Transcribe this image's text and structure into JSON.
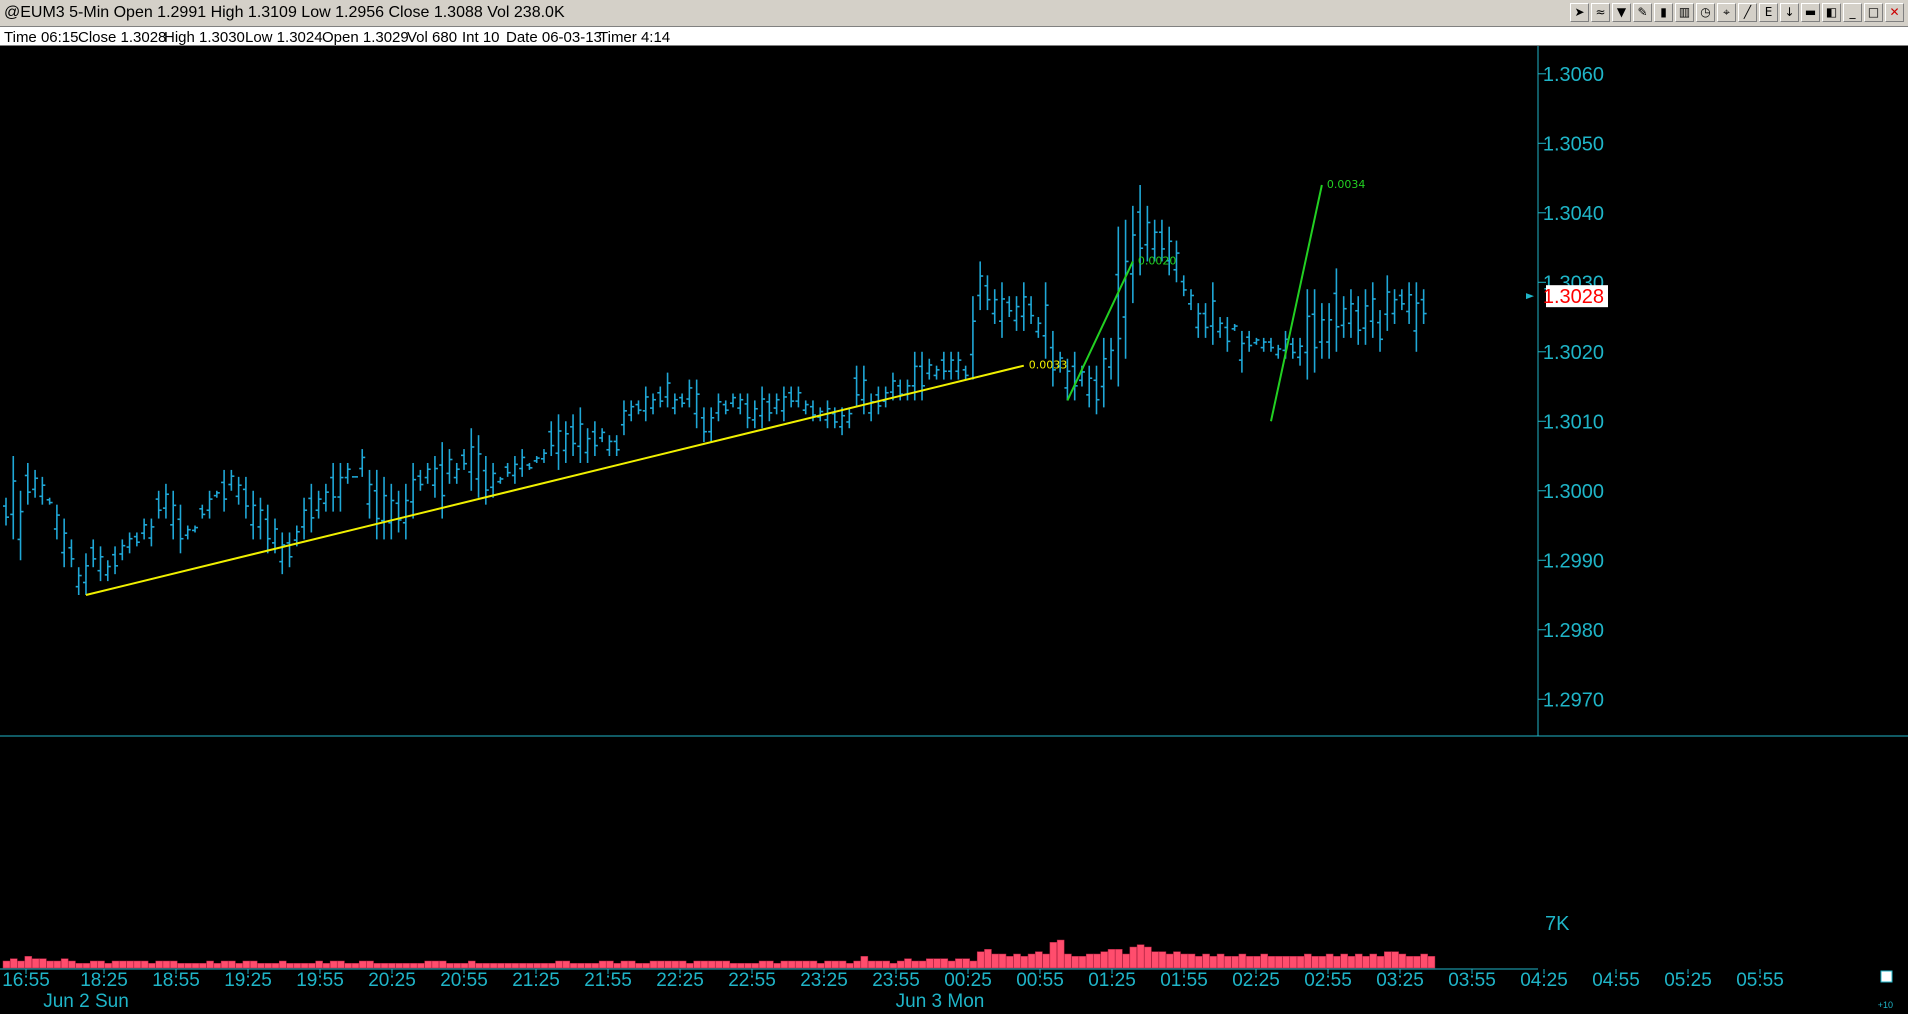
{
  "window": {
    "title": "@EUM3 5-Min Open 1.2991 High 1.3109 Low 1.2956 Close 1.3088 Vol 238.0K",
    "toolbar_icons": [
      "cursor-icon",
      "fibonacci-icon",
      "filter-icon",
      "pencil-icon",
      "bars-icon",
      "chart-icon",
      "clock-icon",
      "crosshair-icon",
      "trendline-icon",
      "text-icon",
      "arrow-down-icon",
      "trash-icon",
      "mirror-icon",
      "minimize-icon",
      "restore-icon",
      "close-icon"
    ],
    "toolbar_glyphs": [
      "➤",
      "≈",
      "▼",
      "✎",
      "▮",
      "▥",
      "◷",
      "⌖",
      "╱",
      "E",
      "↓",
      "▬",
      "◧",
      "_",
      "□",
      "✕"
    ]
  },
  "infobar": {
    "time": "Time 06:15",
    "close": "Close 1.3028",
    "high": "High 1.3030",
    "low": "Low 1.3024",
    "open": "Open 1.3029",
    "vol": "Vol 680",
    "int": "Int 10",
    "date": "Date 06-03-13",
    "timer": "Timer 4:14"
  },
  "colors": {
    "background": "#000000",
    "bars": "#1fa7d6",
    "axis": "#1fb5c8",
    "yellow_line": "#f0f000",
    "green_line": "#22d022",
    "last_price_bg": "#ffffff",
    "last_price_text": "#ff0000",
    "volume": "#ff4d6d"
  },
  "chart_data": {
    "type": "bar",
    "subtype": "ohlc",
    "ylim": [
      1.2965,
      1.3064
    ],
    "y_ticks": [
      "1.3060",
      "1.3050",
      "1.3040",
      "1.3030",
      "1.3020",
      "1.3010",
      "1.3000",
      "1.2990",
      "1.2980",
      "1.2970"
    ],
    "x_tick_labels": [
      "16:55",
      "18:25",
      "18:55",
      "19:25",
      "19:55",
      "20:25",
      "20:55",
      "21:25",
      "21:55",
      "22:25",
      "22:55",
      "23:25",
      "23:55",
      "00:25",
      "00:55",
      "01:25",
      "01:55",
      "02:25",
      "02:55",
      "03:25",
      "03:55",
      "04:25",
      "04:55",
      "05:25",
      "05:55"
    ],
    "date_labels": [
      "Jun 2 Sun",
      "Jun 3 Mon"
    ],
    "last_price": "1.3028",
    "volume_label": "7K",
    "corner_label": "+10",
    "lows": [
      1.2995,
      1.2993,
      1.299,
      1.2998,
      1.2999,
      1.2998,
      1.2998,
      1.2993,
      1.2989,
      1.2989,
      1.2985,
      1.2985,
      1.2989,
      1.2987,
      1.2987,
      1.2988,
      1.299,
      1.2991,
      1.2992,
      1.2993,
      1.2992,
      1.2996,
      1.2996,
      1.2993,
      1.2991,
      1.2993,
      1.2994,
      1.2996,
      1.2996,
      1.2999,
      1.2997,
      1.3,
      1.2998,
      1.2996,
      1.2993,
      1.2993,
      1.2991,
      1.2991,
      1.2988,
      1.2989,
      1.2992,
      1.2993,
      1.2994,
      1.2996,
      1.2997,
      1.2997,
      1.2997,
      1.3001,
      1.3002,
      1.3002,
      1.2996,
      1.2993,
      1.2993,
      1.2993,
      1.2994,
      1.2993,
      1.2996,
      1.3,
      1.3001,
      1.2999,
      1.2996,
      1.3001,
      1.3001,
      1.3003,
      1.3,
      1.2999,
      1.2998,
      1.2999,
      1.3001,
      1.3002,
      1.3001,
      1.3002,
      1.3003,
      1.3004,
      1.3004,
      1.3005,
      1.3003,
      1.3004,
      1.3005,
      1.3004,
      1.3004,
      1.3005,
      1.3007,
      1.3005,
      1.3005,
      1.3008,
      1.301,
      1.3011,
      1.301,
      1.3011,
      1.3012,
      1.3012,
      1.3011,
      1.3012,
      1.3012,
      1.3009,
      1.3007,
      1.3007,
      1.301,
      1.3011,
      1.3012,
      1.3011,
      1.3009,
      1.3009,
      1.3009,
      1.301,
      1.3011,
      1.301,
      1.3012,
      1.3012,
      1.3011,
      1.301,
      1.301,
      1.3009,
      1.3009,
      1.3008,
      1.3009,
      1.3012,
      1.3011,
      1.301,
      1.3011,
      1.3012,
      1.3013,
      1.3013,
      1.3013,
      1.3013,
      1.3013,
      1.3016,
      1.3016,
      1.3016,
      1.3016,
      1.3016,
      1.3016,
      1.3016,
      1.3026,
      1.3026,
      1.3024,
      1.3022,
      1.3025,
      1.3023,
      1.3023,
      1.3024,
      1.3022,
      1.3019,
      1.3015,
      1.3017,
      1.3013,
      1.3013,
      1.3015,
      1.3012,
      1.3011,
      1.3012,
      1.3016,
      1.3015,
      1.3019,
      1.3027,
      1.3031,
      1.3033,
      1.3033,
      1.3033,
      1.3031,
      1.303,
      1.3028,
      1.3026,
      1.3022,
      1.3022,
      1.3021,
      1.3022,
      1.302,
      1.3023,
      1.3017,
      1.302,
      1.3021,
      1.302,
      1.302,
      1.3019,
      1.3019,
      1.3019,
      1.3018,
      1.3016,
      1.3017,
      1.3019,
      1.3019,
      1.302,
      1.3022,
      1.3022,
      1.3021,
      1.3021,
      1.3022,
      1.302,
      1.3023,
      1.3024,
      1.3026,
      1.3024,
      1.302,
      1.3024,
      1.3026,
      1.3024
    ],
    "highs": [
      1.2999,
      1.3005,
      1.3,
      1.3004,
      1.3003,
      1.3002,
      1.2999,
      1.2998,
      1.2996,
      1.2993,
      1.2989,
      1.2991,
      1.2993,
      1.2992,
      1.299,
      1.2992,
      1.2993,
      1.2994,
      1.2994,
      1.2996,
      1.2996,
      1.3,
      1.3001,
      1.3,
      1.2998,
      1.2995,
      1.2995,
      1.2998,
      1.3,
      1.3,
      1.3003,
      1.3003,
      1.3002,
      1.3002,
      1.3,
      1.2999,
      1.2998,
      1.2996,
      1.2994,
      1.2994,
      1.2995,
      1.2999,
      1.3001,
      1.3,
      1.3001,
      1.3004,
      1.3004,
      1.3004,
      1.3002,
      1.3006,
      1.3003,
      1.3003,
      1.3002,
      1.3001,
      1.3,
      1.3001,
      1.3004,
      1.3003,
      1.3004,
      1.3005,
      1.3007,
      1.3006,
      1.3004,
      1.3006,
      1.3009,
      1.3008,
      1.3005,
      1.3004,
      1.3002,
      1.3004,
      1.3005,
      1.3006,
      1.3004,
      1.3005,
      1.3006,
      1.301,
      1.3011,
      1.301,
      1.3011,
      1.3012,
      1.3009,
      1.301,
      1.3009,
      1.3008,
      1.3008,
      1.3013,
      1.3013,
      1.3013,
      1.3015,
      1.3014,
      1.3015,
      1.3017,
      1.3014,
      1.3014,
      1.3016,
      1.3016,
      1.3012,
      1.3012,
      1.3014,
      1.3013,
      1.3014,
      1.3014,
      1.3014,
      1.3013,
      1.3015,
      1.3014,
      1.3014,
      1.3015,
      1.3015,
      1.3015,
      1.3013,
      1.3013,
      1.3012,
      1.3013,
      1.3012,
      1.3012,
      1.3012,
      1.3018,
      1.3018,
      1.3014,
      1.3015,
      1.3015,
      1.3017,
      1.3016,
      1.3016,
      1.302,
      1.302,
      1.3019,
      1.3018,
      1.302,
      1.302,
      1.302,
      1.3018,
      1.3028,
      1.3033,
      1.3031,
      1.3029,
      1.303,
      1.3028,
      1.3028,
      1.303,
      1.3028,
      1.3025,
      1.303,
      1.3023,
      1.302,
      1.3019,
      1.302,
      1.3018,
      1.3018,
      1.3018,
      1.3022,
      1.3022,
      1.3038,
      1.3039,
      1.3041,
      1.3044,
      1.3041,
      1.3039,
      1.3039,
      1.3038,
      1.3036,
      1.3031,
      1.3029,
      1.3027,
      1.3027,
      1.303,
      1.3025,
      1.3025,
      1.3024,
      1.3023,
      1.3023,
      1.3022,
      1.3022,
      1.3022,
      1.3021,
      1.3023,
      1.3022,
      1.3022,
      1.3029,
      1.3029,
      1.3027,
      1.3027,
      1.3032,
      1.3028,
      1.3029,
      1.3028,
      1.3029,
      1.303,
      1.3026,
      1.3031,
      1.3029,
      1.3029,
      1.303,
      1.303,
      1.3029
    ],
    "volumes": [
      0.3,
      0.4,
      0.3,
      0.5,
      0.4,
      0.4,
      0.3,
      0.3,
      0.4,
      0.3,
      0.2,
      0.2,
      0.3,
      0.3,
      0.2,
      0.3,
      0.3,
      0.3,
      0.3,
      0.3,
      0.2,
      0.3,
      0.3,
      0.3,
      0.2,
      0.2,
      0.2,
      0.2,
      0.3,
      0.2,
      0.3,
      0.3,
      0.2,
      0.3,
      0.3,
      0.2,
      0.2,
      0.2,
      0.3,
      0.2,
      0.2,
      0.2,
      0.2,
      0.3,
      0.2,
      0.3,
      0.3,
      0.2,
      0.2,
      0.3,
      0.3,
      0.2,
      0.2,
      0.2,
      0.2,
      0.2,
      0.2,
      0.2,
      0.3,
      0.3,
      0.3,
      0.2,
      0.2,
      0.2,
      0.3,
      0.2,
      0.2,
      0.2,
      0.2,
      0.2,
      0.2,
      0.2,
      0.2,
      0.2,
      0.2,
      0.2,
      0.3,
      0.3,
      0.2,
      0.2,
      0.2,
      0.2,
      0.3,
      0.3,
      0.2,
      0.3,
      0.3,
      0.2,
      0.2,
      0.3,
      0.3,
      0.3,
      0.3,
      0.3,
      0.2,
      0.3,
      0.3,
      0.3,
      0.3,
      0.3,
      0.2,
      0.2,
      0.2,
      0.2,
      0.3,
      0.3,
      0.2,
      0.3,
      0.3,
      0.3,
      0.3,
      0.3,
      0.2,
      0.3,
      0.3,
      0.3,
      0.2,
      0.3,
      0.5,
      0.3,
      0.3,
      0.3,
      0.2,
      0.3,
      0.4,
      0.3,
      0.3,
      0.4,
      0.4,
      0.4,
      0.3,
      0.4,
      0.4,
      0.3,
      0.7,
      0.8,
      0.6,
      0.6,
      0.5,
      0.6,
      0.5,
      0.6,
      0.7,
      0.6,
      1.1,
      1.2,
      0.6,
      0.5,
      0.5,
      0.6,
      0.6,
      0.7,
      0.8,
      0.8,
      0.6,
      0.9,
      1.0,
      0.9,
      0.7,
      0.7,
      0.6,
      0.7,
      0.6,
      0.6,
      0.5,
      0.6,
      0.5,
      0.6,
      0.5,
      0.5,
      0.6,
      0.5,
      0.5,
      0.6,
      0.5,
      0.5,
      0.5,
      0.5,
      0.5,
      0.6,
      0.5,
      0.5,
      0.6,
      0.5,
      0.6,
      0.5,
      0.6,
      0.5,
      0.6,
      0.5,
      0.7,
      0.7,
      0.6,
      0.5,
      0.5,
      0.6,
      0.5
    ],
    "trendlines": [
      {
        "from_bar": 11,
        "from_price": 1.2985,
        "to_bar": 140,
        "to_price": 1.3018,
        "label": "0.0033",
        "color": "yellow"
      },
      {
        "from_bar": 146,
        "from_price": 1.3013,
        "to_bar": 155,
        "to_price": 1.3033,
        "label": "0.0020",
        "color": "green"
      },
      {
        "from_bar": 174,
        "from_price": 1.301,
        "to_bar": 181,
        "to_price": 1.3044,
        "label": "0.0034",
        "color": "green"
      }
    ]
  }
}
